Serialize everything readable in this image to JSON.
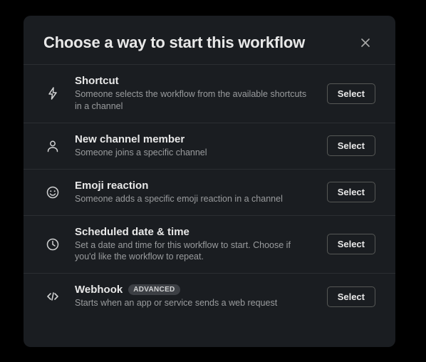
{
  "modal": {
    "title": "Choose a way to start this workflow",
    "select_label": "Select",
    "advanced_badge": "ADVANCED"
  },
  "options": [
    {
      "title": "Shortcut",
      "desc": "Someone selects the workflow from the available shortcuts in a channel"
    },
    {
      "title": "New channel member",
      "desc": "Someone joins a specific channel"
    },
    {
      "title": "Emoji reaction",
      "desc": "Someone adds a specific emoji reaction in a channel"
    },
    {
      "title": "Scheduled date & time",
      "desc": "Set a date and time for this workflow to start. Choose if you'd like the workflow to repeat."
    },
    {
      "title": "Webhook",
      "desc": "Starts when an app or service sends a web request",
      "badge": true
    }
  ]
}
